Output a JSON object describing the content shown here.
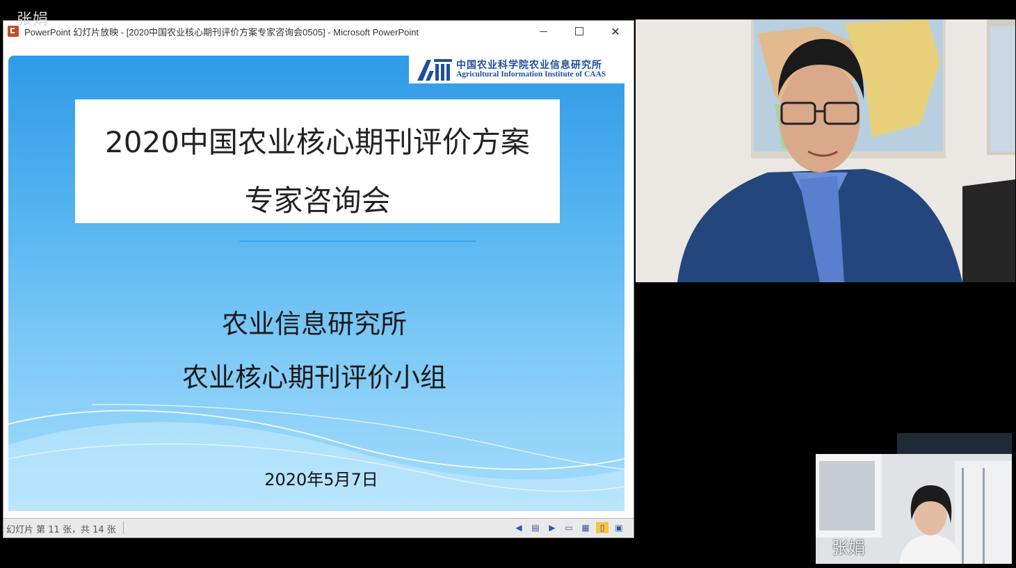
{
  "meeting": {
    "presenter_label": "张娟",
    "small_tile_name": "张娟"
  },
  "window": {
    "title": "PowerPoint 幻灯片放映 - [2020中国农业核心期刊评价方案专家咨询会0505] - Microsoft PowerPoint",
    "minimize_glyph": "—",
    "maximize_glyph": "☐",
    "close_glyph": "✕"
  },
  "slide": {
    "logo_cn": "中国农业科学院农业信息研究所",
    "logo_en": "Agricultural Information Institute of CAAS",
    "title_line1": "2020中国农业核心期刊评价方案",
    "title_line2": "专家咨询会",
    "org_line1": "农业信息研究所",
    "org_line2": "农业核心期刊评价小组",
    "date": "2020年5月7日"
  },
  "statusbar": {
    "slide_counter": "幻灯片 第 11 张，共 14 张",
    "icons": [
      "prev-icon",
      "menu-icon",
      "next-icon",
      "normal-view-icon",
      "slide-sorter-icon",
      "reading-view-icon",
      "slideshow-icon"
    ]
  },
  "colors": {
    "slide_top": "#2f9ae6",
    "slide_bottom": "#a5dcfb",
    "logo_blue": "#1d4f9e"
  }
}
